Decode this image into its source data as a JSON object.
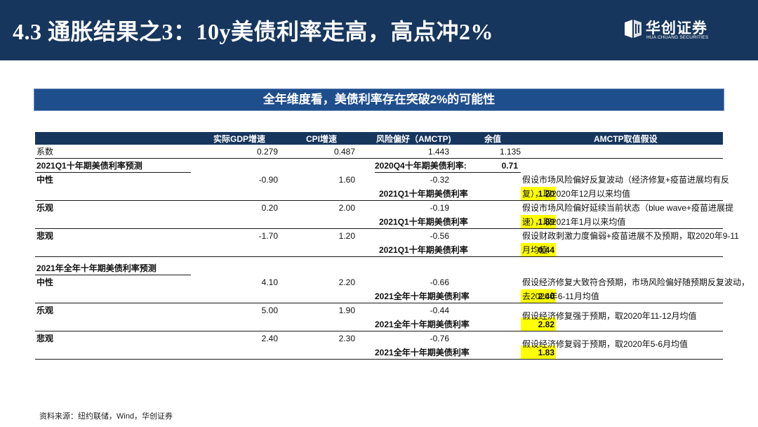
{
  "header": {
    "title": "4.3 通胀结果之3：10y美债利率走高，高点冲2%",
    "logo_cn": "华创证券",
    "logo_en": "HUA CHUANG SECURITIES"
  },
  "banner": {
    "text": "全年维度看，美债利率存在突破2%的可能性"
  },
  "table": {
    "columns": [
      "实际GDP增速",
      "CPI增速",
      "风险偏好（AMCTP)",
      "余值",
      "AMCTP取值假设"
    ],
    "coef": {
      "label": "系数",
      "gdp": "0.279",
      "cpi": "0.487",
      "risk": "1.443",
      "resid": "1.135"
    },
    "q1": {
      "section_label": "2021Q1十年期美债利率预测",
      "prev_label": "2020Q4十年期美债利率:",
      "prev_value": "0.71",
      "rate_label": "2021Q1十年期美债利率",
      "rows": [
        {
          "scenario": "中性",
          "gdp": "-0.90",
          "cpi": "1.60",
          "risk": "-0.32",
          "rate": "1.20",
          "note1": "假设市场风险偏好反复波动（经济修复+疫苗进展均有反",
          "note2": "复），取2020年12月以来均值"
        },
        {
          "scenario": "乐观",
          "gdp": "0.20",
          "cpi": "2.00",
          "risk": "-0.19",
          "rate": "1.89",
          "note1": "假设市场风险偏好延续当前状态（blue wave+疫苗进展提",
          "note2": "速），取2021年1月以来均值"
        },
        {
          "scenario": "悲观",
          "gdp": "-1.70",
          "cpi": "1.20",
          "risk": "-0.56",
          "rate": "0.44",
          "note1": "假设财政刺激力度偏弱+疫苗进展不及预期，取2020年9-11",
          "note2": "月均值"
        }
      ]
    },
    "fy": {
      "section_label": "2021年全年十年期美债利率预测",
      "rate_label": "2021全年十年期美债利率",
      "rows": [
        {
          "scenario": "中性",
          "gdp": "4.10",
          "cpi": "2.20",
          "risk": "-0.66",
          "rate": "2.40",
          "note1": "假设经济修复大致符合预期，市场风险偏好随预期反复波动，",
          "note2": "去2020年6-11月均值"
        },
        {
          "scenario": "乐观",
          "gdp": "5.00",
          "cpi": "1.90",
          "risk": "-0.44",
          "rate": "2.82",
          "note1": "假设经济修复强于预期，取2020年11-12月均值"
        },
        {
          "scenario": "悲观",
          "gdp": "2.40",
          "cpi": "2.30",
          "risk": "-0.76",
          "rate": "1.83",
          "note1": "假设经济修复弱于预期，取2020年5-6月均值"
        }
      ]
    }
  },
  "footer": {
    "source": "资料来源：纽约联储，Wind，华创证券"
  },
  "colors": {
    "header_bg": "#17365d",
    "banner_bg": "#1f4e8c",
    "highlight": "#ffff00"
  }
}
